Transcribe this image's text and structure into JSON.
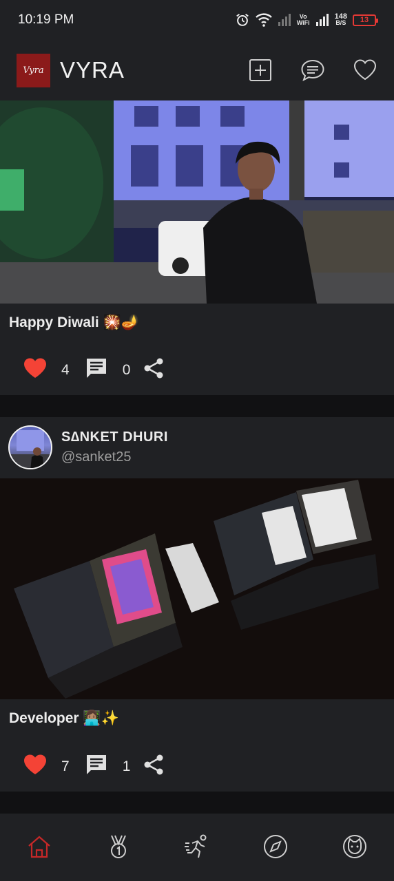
{
  "status_bar": {
    "time": "10:19 PM",
    "vowifi_top": "Vo",
    "vowifi_bottom": "WiFi",
    "speed_value": "148",
    "speed_unit": "B/S",
    "battery": "13"
  },
  "header": {
    "logo_text": "Vyra",
    "title": "VYRA",
    "icons": [
      "add-post-icon",
      "messages-icon",
      "heart-icon"
    ]
  },
  "posts": [
    {
      "caption": "Happy Diwali 🎇🪔",
      "likes": "4",
      "comments": "0"
    },
    {
      "author_name": "S∆NKET DHURI",
      "author_handle": "@sanket25",
      "caption": "Developer 👩🏽‍💻✨",
      "likes": "7",
      "comments": "1"
    }
  ],
  "bottom_nav": {
    "items": [
      "home-icon",
      "medal-icon",
      "run-icon",
      "compass-icon",
      "cat-face-icon"
    ],
    "active": "home-icon",
    "active_color": "#c62828"
  },
  "colors": {
    "like": "#f44336",
    "card": "#202124",
    "background": "#111113"
  }
}
